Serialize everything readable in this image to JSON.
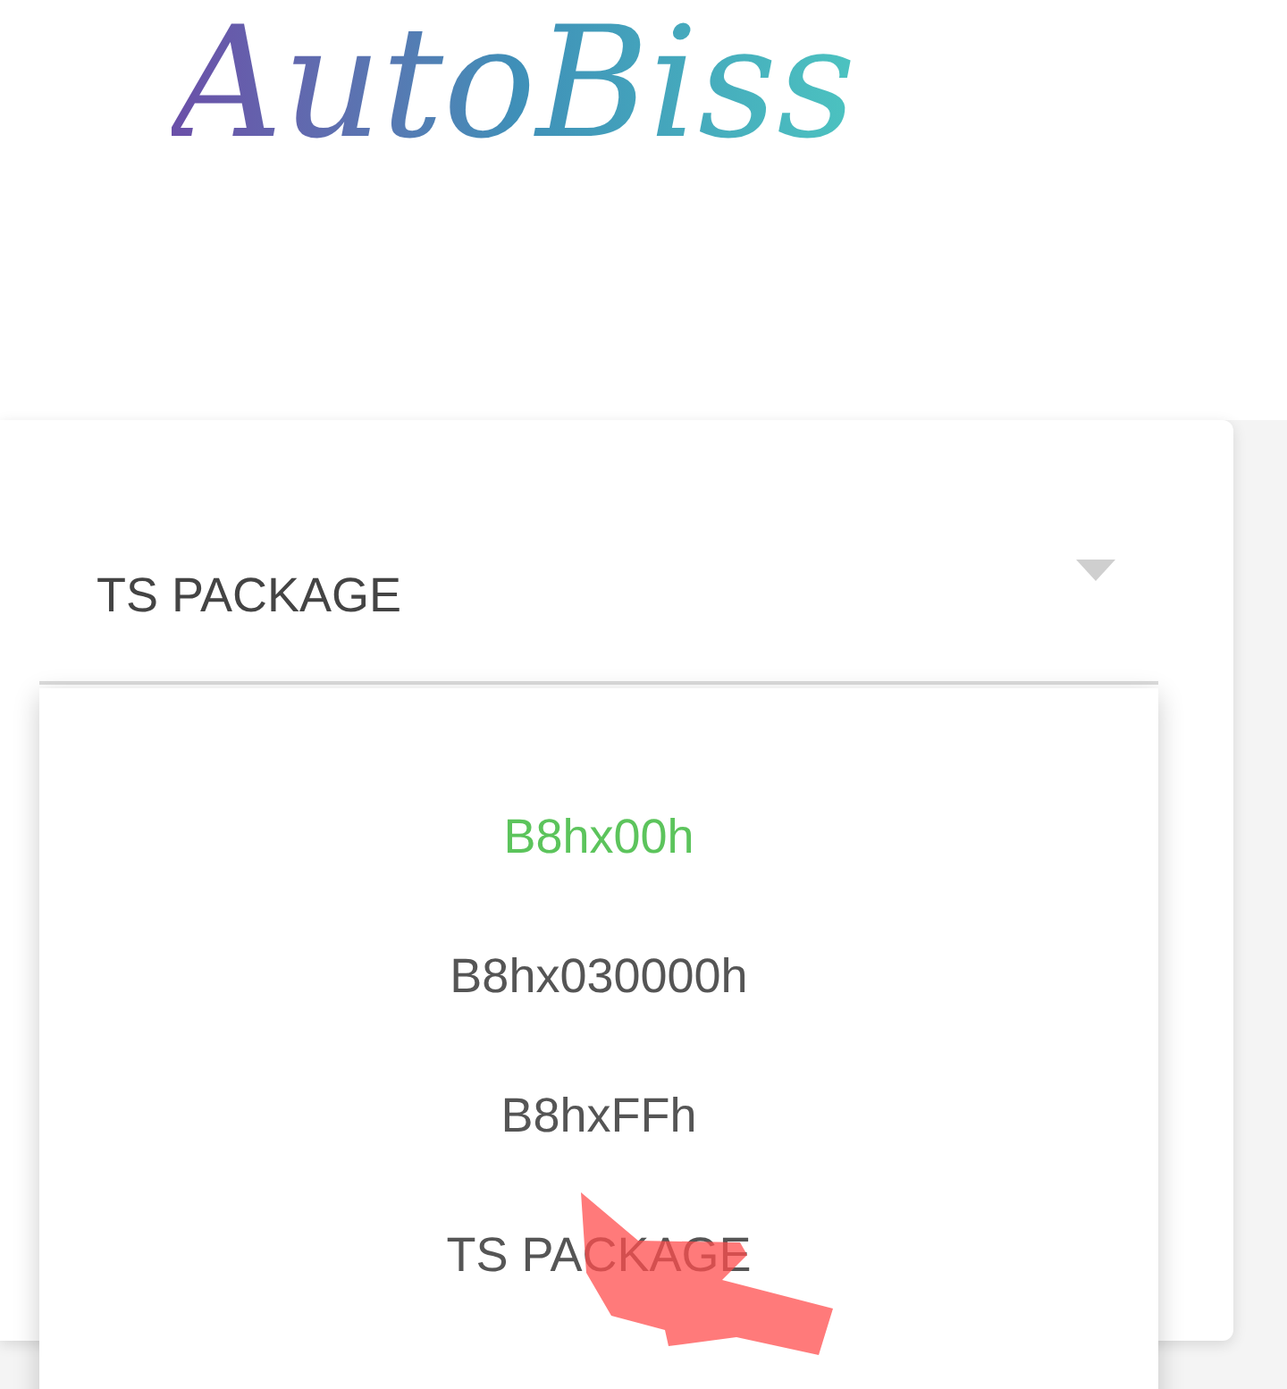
{
  "logo": {
    "text": "AutoBiss"
  },
  "select": {
    "value": "TS PACKAGE",
    "expanded": true
  },
  "menu": {
    "items": [
      {
        "label": "B8hx00h",
        "selected": true
      },
      {
        "label": "B8hx030000h",
        "selected": false
      },
      {
        "label": "B8hxFFh",
        "selected": false
      },
      {
        "label": "TS PACKAGE",
        "selected": false
      }
    ]
  }
}
